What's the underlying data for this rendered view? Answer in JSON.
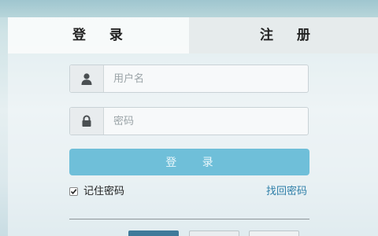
{
  "tabs": {
    "login_label": "登 录",
    "register_label": "注 册"
  },
  "form": {
    "username": {
      "icon": "user-icon",
      "value": "",
      "placeholder": "用户名"
    },
    "password": {
      "icon": "lock-icon",
      "value": "",
      "placeholder": "密码"
    },
    "login_button_label": "登 录",
    "remember_label": "记住密码",
    "remember_checked": true,
    "forgot_link_label": "找回密码"
  },
  "colors": {
    "login_button": "#6fbfd9",
    "link": "#2f7fa8",
    "bottom_primary": "#3f7a9a"
  }
}
